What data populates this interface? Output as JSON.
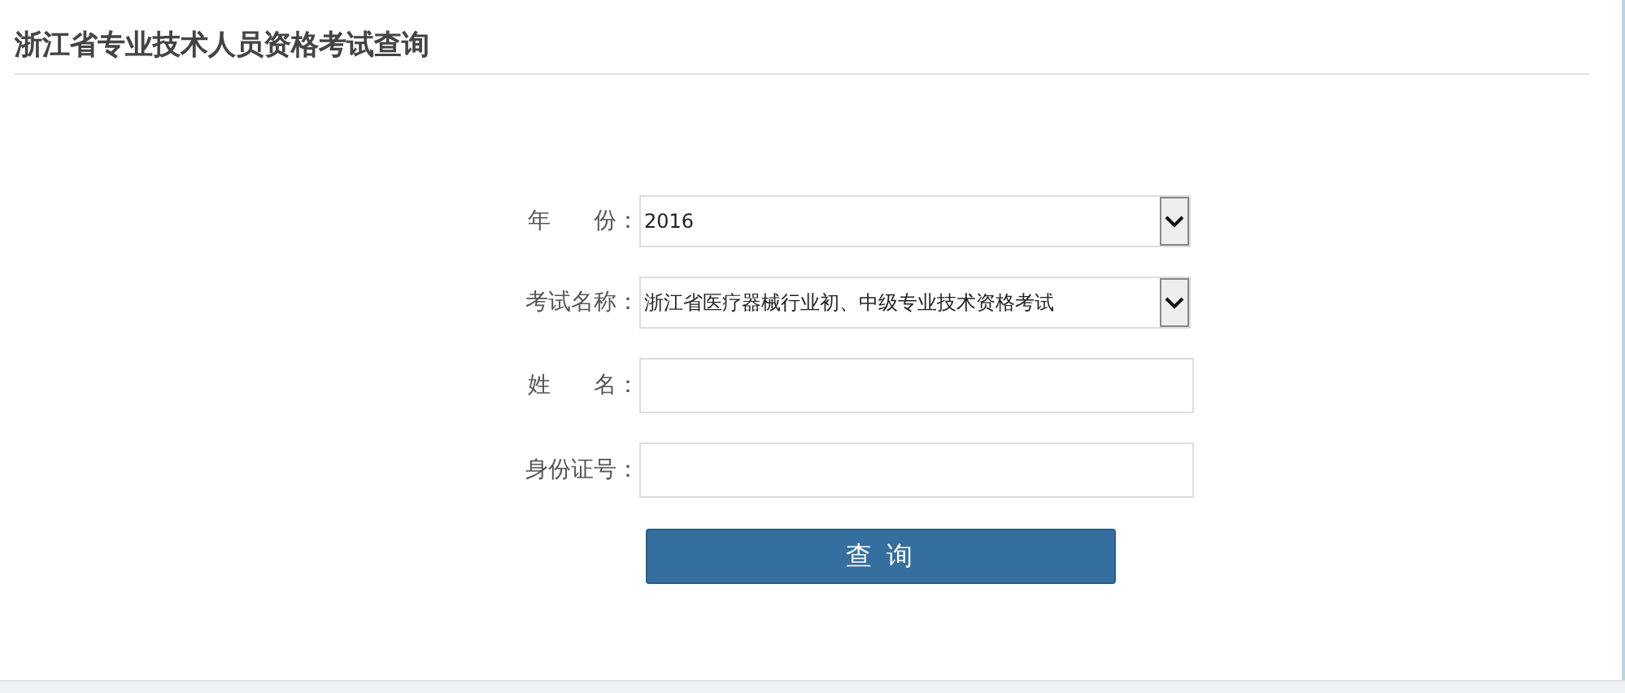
{
  "page_title": "浙江省专业技术人员资格考试查询",
  "form": {
    "fields": [
      {
        "kind": "select",
        "label": "年 份：",
        "value": "2016"
      },
      {
        "kind": "select",
        "label": "考试名称：",
        "value": "浙江省医疗器械行业初、中级专业技术资格考试"
      },
      {
        "kind": "text",
        "label": "姓 名："
      },
      {
        "kind": "text",
        "label": "身份证号："
      }
    ],
    "submit": "查 询"
  }
}
